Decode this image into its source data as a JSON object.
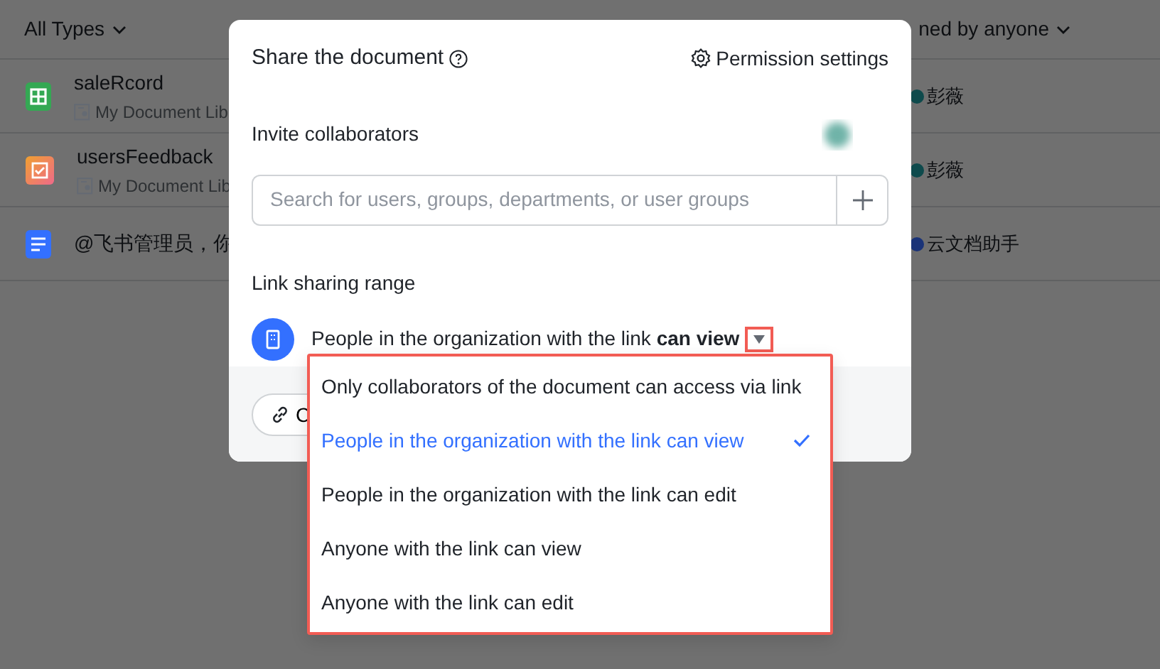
{
  "background": {
    "filters": [
      {
        "label": "All Types"
      },
      {
        "label": "ned by anyone"
      }
    ],
    "rows": [
      {
        "kind": "sheet",
        "title": "saleRcord",
        "location": "My Document Lib",
        "owner": "彭薇",
        "color": "#0e4a4c"
      },
      {
        "kind": "form",
        "title": "usersFeedback",
        "location": "My Document Lib",
        "owner": "彭薇",
        "color": "#0e4a4c"
      },
      {
        "kind": "doc",
        "title": "@飞书管理员，你",
        "owner": "云文档助手",
        "color": "#1a3378"
      }
    ]
  },
  "dialog": {
    "title": "Share the document",
    "settings_link": "Permission settings",
    "invite_label": "Invite collaborators",
    "search": {
      "placeholder": "Search for users, groups, departments, or user groups"
    },
    "link_range_label": "Link sharing range",
    "link_range_value": "People in the organization with the link **can view**",
    "copy_button": "C",
    "menu": {
      "options": [
        {
          "label": "Only collaborators of the document can access via link",
          "selected": false
        },
        {
          "label": "People in the organization with the link can view",
          "selected": true
        },
        {
          "label": "People in the organization with the link can edit",
          "selected": false
        },
        {
          "label": "Anyone with the link can view",
          "selected": false
        },
        {
          "label": "Anyone with the link can edit",
          "selected": false
        }
      ]
    }
  }
}
